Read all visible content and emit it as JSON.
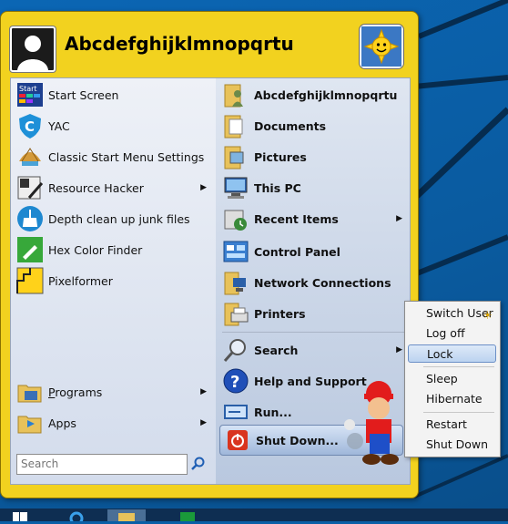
{
  "user": {
    "name": "Abcdefghijklmnopqrtu"
  },
  "left_items": [
    {
      "label": "Start Screen",
      "icon": "start-screen-icon",
      "submenu": false
    },
    {
      "label": "YAC",
      "icon": "yac-shield-icon",
      "submenu": false
    },
    {
      "label": "Classic Start Menu Settings",
      "icon": "shell-icon",
      "submenu": false
    },
    {
      "label": "Resource Hacker",
      "icon": "resource-hacker-icon",
      "submenu": true
    },
    {
      "label": "Depth clean up junk files",
      "icon": "broom-icon",
      "submenu": false
    },
    {
      "label": "Hex Color Finder",
      "icon": "eyedropper-icon",
      "submenu": false
    },
    {
      "label": "Pixelformer",
      "icon": "pixelformer-icon",
      "submenu": false
    }
  ],
  "bottom_left": [
    {
      "label_pre": "",
      "label_u": "P",
      "label_post": "rograms",
      "icon": "programs-folder-icon",
      "submenu": true
    },
    {
      "label_pre": "",
      "label_u": "",
      "label_post": "Apps",
      "icon": "apps-icon",
      "submenu": true
    }
  ],
  "search": {
    "placeholder": "Search"
  },
  "right_items": [
    {
      "label": "Abcdefghijklmnopqrtu",
      "icon": "user-folder-icon",
      "submenu": false
    },
    {
      "label": "Documents",
      "icon": "documents-folder-icon",
      "submenu": false
    },
    {
      "label": "Pictures",
      "icon": "pictures-folder-icon",
      "submenu": false
    },
    {
      "label": "This PC",
      "icon": "computer-icon",
      "submenu": false
    },
    {
      "label": "Recent Items",
      "icon": "recent-items-icon",
      "submenu": true
    },
    {
      "label": "Control Panel",
      "icon": "control-panel-icon",
      "submenu": false
    },
    {
      "label": "Network Connections",
      "icon": "network-icon",
      "submenu": false
    },
    {
      "label": "Printers",
      "icon": "printer-icon",
      "submenu": false
    },
    {
      "label": "Search",
      "icon": "magnifier-icon",
      "submenu": true
    },
    {
      "label": "Help and Support",
      "icon": "help-icon",
      "submenu": false
    },
    {
      "label": "Run...",
      "icon": "run-icon",
      "submenu": false
    }
  ],
  "shutdown": {
    "label": "Shut Down..."
  },
  "shutdown_menu": [
    {
      "label": "Switch User"
    },
    {
      "label": "Log off"
    },
    {
      "label": "Lock"
    },
    {
      "label": "Sleep"
    },
    {
      "label": "Hibernate"
    },
    {
      "label": "Restart"
    },
    {
      "label": "Shut Down"
    }
  ],
  "colors": {
    "menu_frame": "#f2d21f",
    "desktop": "#0a5fa6",
    "shutdown_icon": "#d9341f"
  }
}
